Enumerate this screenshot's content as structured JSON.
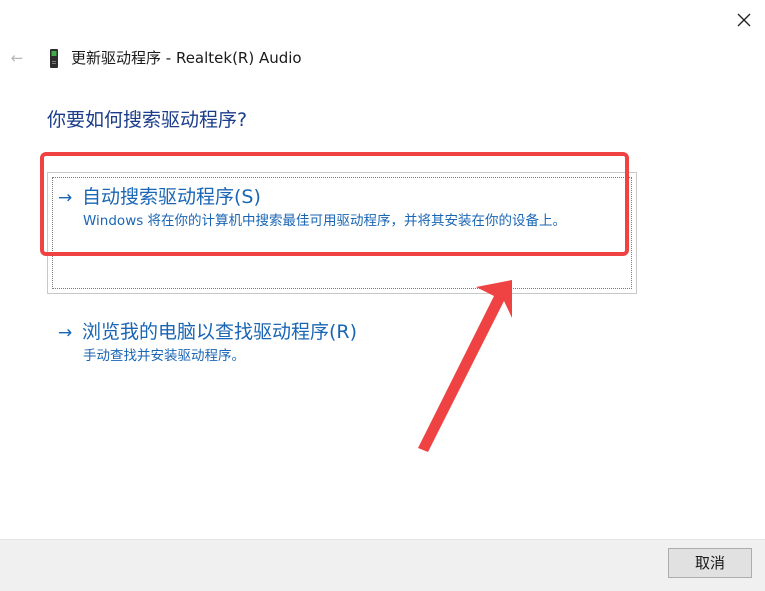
{
  "window": {
    "title": "更新驱动程序 - Realtek(R) Audio",
    "back_glyph": "←",
    "close_icon": "close-icon",
    "device_icon": "audio-device-icon"
  },
  "main": {
    "heading": "你要如何搜索驱动程序?",
    "options": [
      {
        "arrow": "→",
        "title": "自动搜索驱动程序(S)",
        "description": "Windows 将在你的计算机中搜索最佳可用驱动程序，并将其安装在你的设备上。"
      },
      {
        "arrow": "→",
        "title": "浏览我的电脑以查找驱动程序(R)",
        "description": "手动查找并安装驱动程序。"
      }
    ]
  },
  "footer": {
    "cancel_label": "取消"
  },
  "colors": {
    "link": "#1a66b5",
    "heading": "#1b3d8c",
    "annotation": "#ef4343",
    "footer_bg": "#f0f0f0"
  }
}
